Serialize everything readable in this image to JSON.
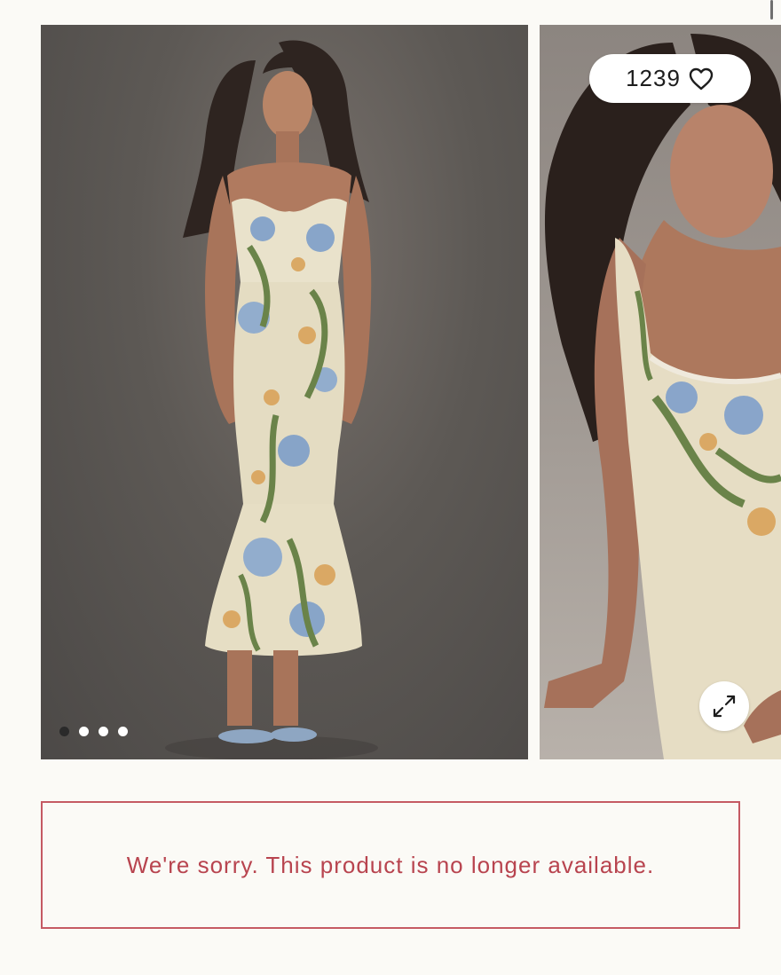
{
  "gallery": {
    "favorites": {
      "count": "1239",
      "icon": "heart-icon"
    },
    "carousel": {
      "total_slides": 4,
      "active_index": 0
    },
    "expand": {
      "icon": "expand-arrows-icon"
    }
  },
  "notice": {
    "message": "We're sorry. This product is no longer available.",
    "border_color": "#c55a63",
    "text_color": "#b8444f"
  }
}
